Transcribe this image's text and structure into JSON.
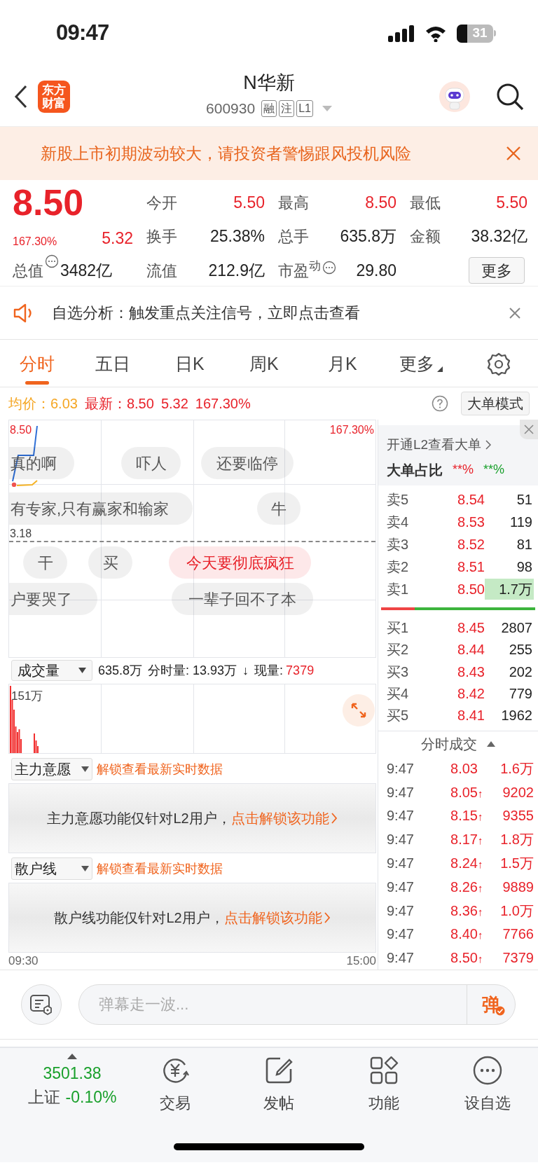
{
  "status_bar": {
    "time": "09:47",
    "battery": "31"
  },
  "header": {
    "logo": "东方财富",
    "title": "N华新",
    "code": "600930",
    "tags": [
      "融",
      "注",
      "L1"
    ]
  },
  "banner": {
    "text": "新股上市初期波动较大，请投资者警惕跟风投机风险"
  },
  "quote": {
    "price": "8.50",
    "change_pct": "167.30%",
    "change": "5.32",
    "market_cap": {
      "label": "总值",
      "value": "3482亿"
    },
    "stats": [
      [
        {
          "label": "今开",
          "value": "5.50",
          "rising": true
        },
        {
          "label": "最高",
          "value": "8.50",
          "rising": true
        },
        {
          "label": "最低",
          "value": "5.50",
          "rising": true
        }
      ],
      [
        {
          "label": "换手",
          "value": "25.38%",
          "rising": false
        },
        {
          "label": "总手",
          "value": "635.8万",
          "rising": false
        },
        {
          "label": "金额",
          "value": "38.32亿",
          "rising": false
        }
      ],
      [
        {
          "label": "流值",
          "value": "212.9亿",
          "rising": false
        },
        {
          "label": "市盈$^{动}$",
          "value": "29.80",
          "rising": false,
          "info": true
        }
      ]
    ],
    "more_button": "更多"
  },
  "notice": {
    "text": "自选分析：触发重点关注信号，立即点击查看"
  },
  "tabs": [
    {
      "label": "分时",
      "selected": true
    },
    {
      "label": "五日",
      "selected": false
    },
    {
      "label": "日K",
      "selected": false
    },
    {
      "label": "周K",
      "selected": false
    },
    {
      "label": "月K",
      "selected": false
    }
  ],
  "more_tab": "更多",
  "info_line": {
    "avg_label": "均价：",
    "avg": "6.03",
    "latest_label": "最新：",
    "latest": "8.50",
    "change": "5.32",
    "change_pct": "167.30%",
    "mode_button": "大单模式"
  },
  "chart": {
    "top_price": "8.50",
    "top_pct": "167.30%",
    "ref_price": "3.18",
    "start_time": "09:30",
    "end_time": "15:00"
  },
  "danmaku": [
    {
      "text": "真的啊",
      "highlighted": false
    },
    {
      "text": "吓人",
      "highlighted": false
    },
    {
      "text": "还要临停",
      "highlighted": false
    },
    {
      "text": "有专家,只有赢家和输家",
      "highlighted": false
    },
    {
      "text": "牛",
      "highlighted": false
    },
    {
      "text": "干",
      "highlighted": false
    },
    {
      "text": "买",
      "highlighted": false
    },
    {
      "text": "今天要彻底疯狂",
      "highlighted": true
    },
    {
      "text": "户要哭了",
      "highlighted": false
    },
    {
      "text": "一辈子回不了本",
      "highlighted": false
    }
  ],
  "volume": {
    "selector": "成交量",
    "total": "635.8万",
    "interval_label": "分时量:",
    "interval": "13.93万",
    "arrow": "↓",
    "current_label": "现量:",
    "current": "7379",
    "max": "151万"
  },
  "indicators": [
    {
      "selector": "主力意愿",
      "unlock": "解锁查看最新实时数据",
      "message": "主力意愿功能仅针对L2用户，",
      "link": "点击解锁该功能"
    },
    {
      "selector": "散户线",
      "unlock": "解锁查看最新实时数据",
      "message": "散户线功能仅针对L2用户，",
      "link": "点击解锁该功能"
    }
  ],
  "order_panel": {
    "l2_link": "开通L2查看大单",
    "ratio_label": "大单占比",
    "buy_ratio": "**%",
    "sell_ratio": "**%",
    "asks": [
      {
        "label": "卖5",
        "price": "8.54",
        "volume": "51",
        "highlighted": false
      },
      {
        "label": "卖4",
        "price": "8.53",
        "volume": "119",
        "highlighted": false
      },
      {
        "label": "卖3",
        "price": "8.52",
        "volume": "81",
        "highlighted": false
      },
      {
        "label": "卖2",
        "price": "8.51",
        "volume": "98",
        "highlighted": false
      },
      {
        "label": "卖1",
        "price": "8.50",
        "volume": "1.7万",
        "highlighted": true
      }
    ],
    "balance": {
      "level": 0.22
    },
    "bids": [
      {
        "label": "买1",
        "price": "8.45",
        "volume": "2807"
      },
      {
        "label": "买2",
        "price": "8.44",
        "volume": "255"
      },
      {
        "label": "买3",
        "price": "8.43",
        "volume": "202"
      },
      {
        "label": "买4",
        "price": "8.42",
        "volume": "779"
      },
      {
        "label": "买5",
        "price": "8.41",
        "volume": "1962"
      }
    ],
    "trades_title": "分时成交",
    "trades": [
      {
        "time": "9:47",
        "price": "8.03",
        "volume": "1.6万"
      },
      {
        "time": "9:47",
        "price": "8.05",
        "arrow": "↑",
        "volume": "9202"
      },
      {
        "time": "9:47",
        "price": "8.15",
        "arrow": "↑",
        "volume": "9355"
      },
      {
        "time": "9:47",
        "price": "8.17",
        "arrow": "↑",
        "volume": "1.8万"
      },
      {
        "time": "9:47",
        "price": "8.24",
        "arrow": "↑",
        "volume": "1.5万"
      },
      {
        "time": "9:47",
        "price": "8.26",
        "arrow": "↑",
        "volume": "9889"
      },
      {
        "time": "9:47",
        "price": "8.36",
        "arrow": "↑",
        "volume": "1.0万"
      },
      {
        "time": "9:47",
        "price": "8.40",
        "arrow": "↑",
        "volume": "7766"
      },
      {
        "time": "9:47",
        "price": "8.50",
        "arrow": "↑",
        "volume": "7379"
      }
    ]
  },
  "comment_bar": {
    "placeholder": "弹幕走一波...",
    "send": "弹"
  },
  "bottom_nav": {
    "index": {
      "value": "3501.38",
      "name": "上证",
      "change": "-0.10%"
    },
    "items": [
      {
        "kind": "trade",
        "label": "交易"
      },
      {
        "kind": "post",
        "label": "发帖"
      },
      {
        "kind": "apps",
        "label": "功能"
      },
      {
        "kind": "more",
        "label": "设自选"
      }
    ]
  }
}
